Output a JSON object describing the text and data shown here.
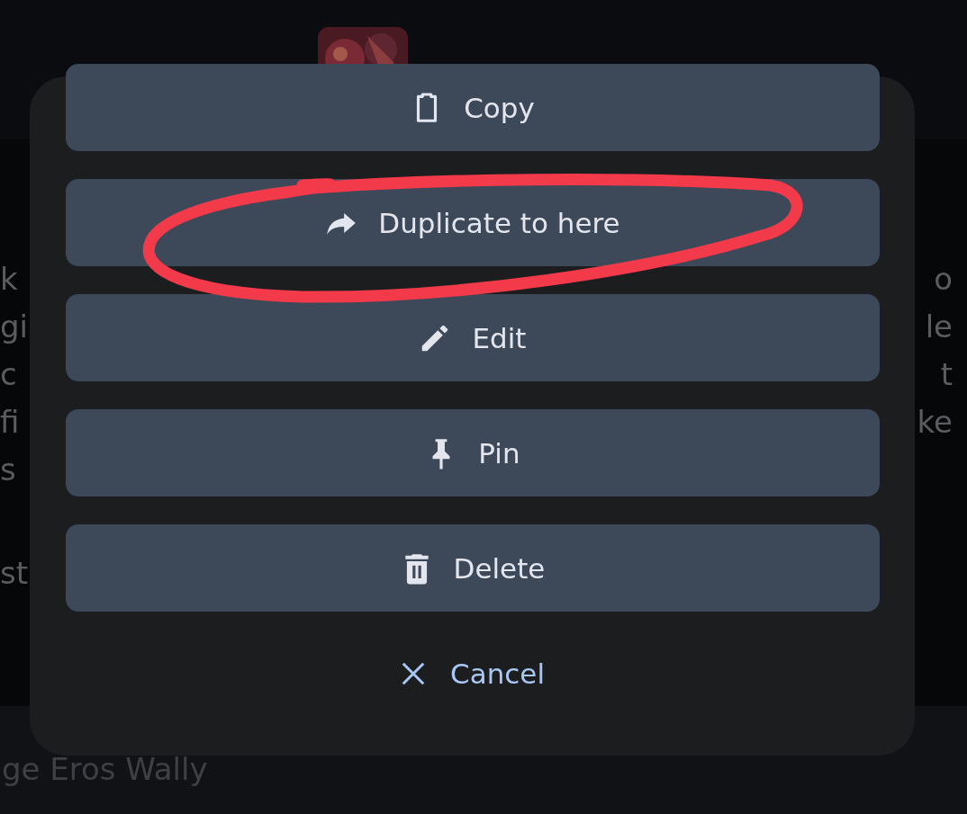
{
  "background_message": {
    "paragraphs": [
      [
        {
          "left": "k",
          "right": "o"
        },
        {
          "left": "gi",
          "right": "le"
        },
        {
          "left": "c",
          "right": "t"
        },
        {
          "left": "fi",
          "right": "ke"
        },
        {
          "left": "s"
        }
      ],
      [
        {
          "left": "st"
        }
      ]
    ]
  },
  "composer": {
    "placeholder": "ge Eros Wally"
  },
  "action_sheet": {
    "actions": [
      {
        "kind": "copy",
        "label": "Copy",
        "circled": false
      },
      {
        "kind": "forward",
        "label": "Duplicate to here",
        "circled": true
      },
      {
        "kind": "edit",
        "label": "Edit",
        "circled": false
      },
      {
        "kind": "pin",
        "label": "Pin",
        "circled": false
      },
      {
        "kind": "delete",
        "label": "Delete",
        "circled": false
      }
    ],
    "cancel": {
      "label": "Cancel"
    }
  }
}
